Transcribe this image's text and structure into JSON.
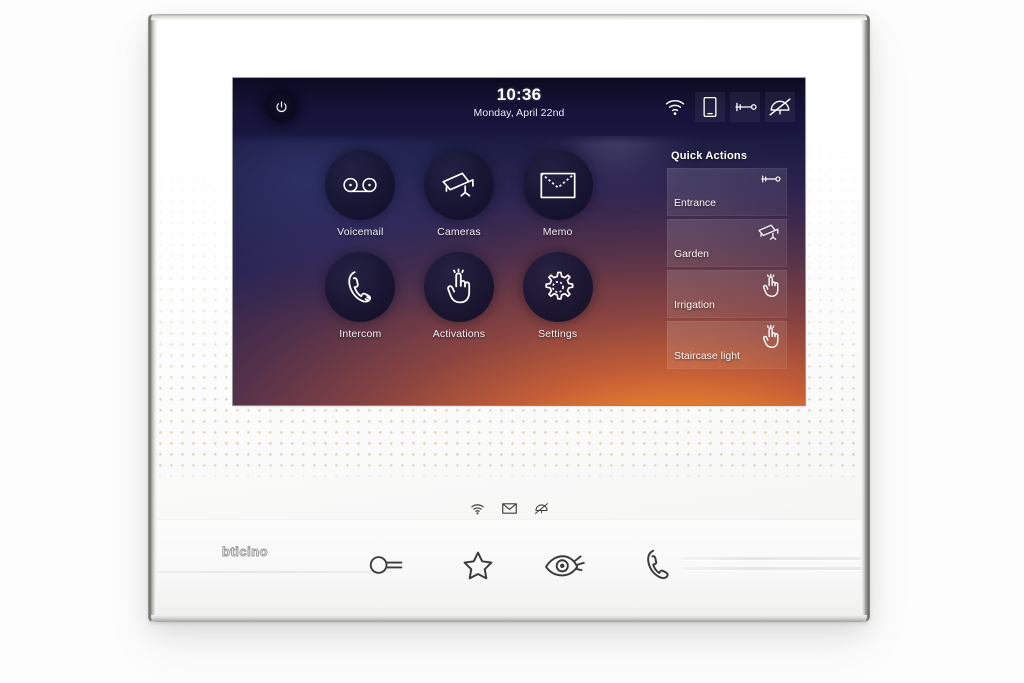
{
  "device": {
    "brand_logo": "bticino",
    "product_type": "video door entry indoor monitor"
  },
  "screen": {
    "statusbar": {
      "power_button_label": "power-button",
      "time": "10:36",
      "date": "Monday, April 22nd",
      "icons": [
        {
          "name": "wifi-icon",
          "label": "Wi-Fi connected",
          "boxed": false
        },
        {
          "name": "mobile-phone-icon",
          "label": "Mobile app paired",
          "boxed": true
        },
        {
          "name": "key-icon",
          "label": "Door lock",
          "boxed": true
        },
        {
          "name": "bell-muted-icon",
          "label": "Ringtone muted",
          "boxed": true
        }
      ]
    },
    "apps": [
      {
        "label": "Voicemail",
        "icon": "voicemail-icon"
      },
      {
        "label": "Cameras",
        "icon": "cctv-camera-icon"
      },
      {
        "label": "Memo",
        "icon": "envelope-icon"
      },
      {
        "label": "Intercom",
        "icon": "phone-handset-icon"
      },
      {
        "label": "Activations",
        "icon": "hand-touch-icon"
      },
      {
        "label": "Settings",
        "icon": "gear-icon"
      }
    ],
    "quick_actions": {
      "title": "Quick Actions",
      "items": [
        {
          "label": "Entrance",
          "icon": "key-icon"
        },
        {
          "label": "Garden",
          "icon": "cctv-camera-icon"
        },
        {
          "label": "Irrigation",
          "icon": "hand-touch-icon"
        },
        {
          "label": "Staircase light",
          "icon": "hand-touch-icon"
        }
      ]
    },
    "colors": {
      "gradient_top_left": "#1a1a3e",
      "gradient_bottom_right": "#ffa02a",
      "statusbar_bg": "#14123a",
      "text": "#ffffff"
    }
  },
  "front_panel": {
    "status_leds": [
      {
        "name": "wifi-led-icon",
        "label": "Wi-Fi status"
      },
      {
        "name": "envelope-led-icon",
        "label": "New message"
      },
      {
        "name": "bell-muted-led-icon",
        "label": "Ringer off"
      }
    ],
    "control_buttons": [
      {
        "name": "door-lock-button",
        "icon": "key-icon",
        "label": "Door lock release"
      },
      {
        "name": "favourites-button",
        "icon": "star-icon",
        "label": "Favourites"
      },
      {
        "name": "self-start-button",
        "icon": "eye-icon",
        "label": "Self-start / camera view"
      },
      {
        "name": "answer-call-button",
        "icon": "phone-handset-icon",
        "label": "Answer call"
      }
    ]
  }
}
